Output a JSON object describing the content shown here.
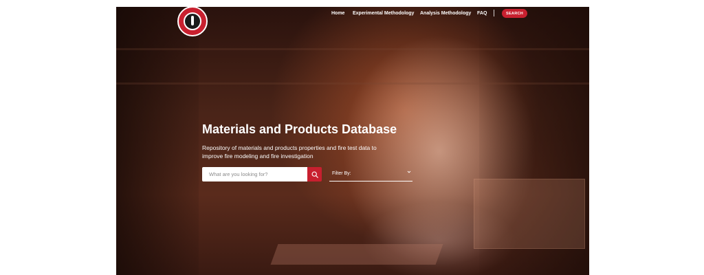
{
  "nav": {
    "items": [
      "Home",
      "Experimental Methodology",
      "Analysis Methodology",
      "FAQ"
    ],
    "search_button": "SEARCH"
  },
  "hero": {
    "title": "Materials and Products Database",
    "subtitle": "Repository of materials and products properties and fire test data to improve fire modeling and fire investigation"
  },
  "search": {
    "placeholder": "What are you looking for?",
    "submit_icon": "search-icon"
  },
  "filter": {
    "label": "Filter By:",
    "icon": "chevron-down-icon"
  },
  "colors": {
    "accent": "#c8202f",
    "text": "#ffffff"
  }
}
